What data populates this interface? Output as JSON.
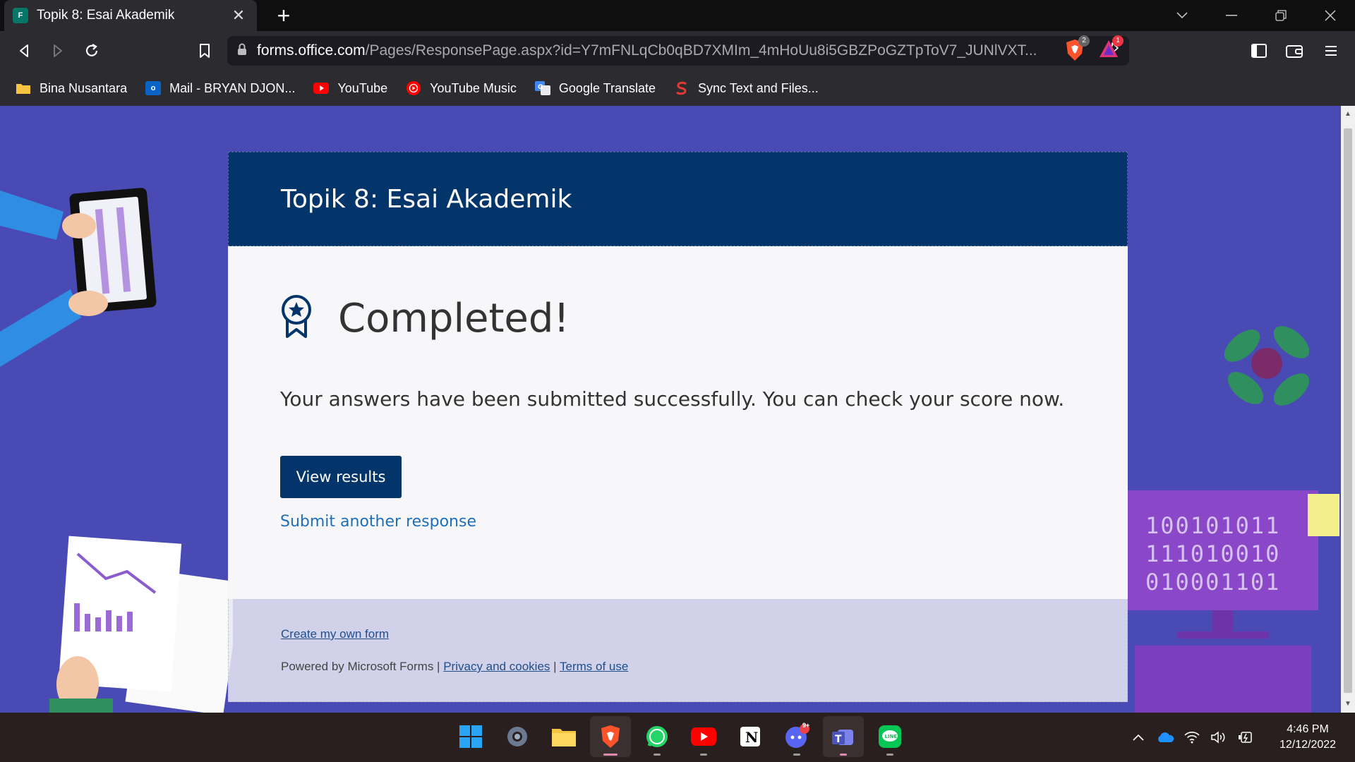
{
  "browser": {
    "tab_title": "Topik 8: Esai Akademik",
    "tab_favicon_text": "F",
    "url_host": "forms.office.com",
    "url_path": "/Pages/ResponsePage.aspx?id=Y7mFNLqCb0qBD7XMIm_4mHoUu8i5GBZPoGZTpToV7_JUNlVXT...",
    "shield_badge": "2",
    "rewards_badge": "1"
  },
  "bookmarks": [
    {
      "label": "Bina Nusantara",
      "icon": "folder-icon",
      "color": "#f5c542"
    },
    {
      "label": "Mail - BRYAN DJON...",
      "icon": "outlook-icon",
      "color": "#0a64c8"
    },
    {
      "label": "YouTube",
      "icon": "youtube-icon",
      "color": "#ff0000"
    },
    {
      "label": "YouTube Music",
      "icon": "youtube-music-icon",
      "color": "#ff0000"
    },
    {
      "label": "Google Translate",
      "icon": "google-translate-icon",
      "color": "#4285f4"
    },
    {
      "label": "Sync Text and Files...",
      "icon": "sync-icon",
      "color": "#e53935"
    }
  ],
  "form": {
    "title": "Topik 8: Esai Akademik",
    "completed": "Completed!",
    "message": "Your answers have been submitted successfully. You can check your score now.",
    "view_results": "View results",
    "submit_another": "Submit another response",
    "create_form": "Create my own form",
    "powered_by": "Powered by Microsoft Forms |",
    "privacy": "Privacy and cookies",
    "separator": "|",
    "terms": "Terms of use"
  },
  "decor": {
    "binary_lines": [
      "100101011",
      "111010010",
      "010001101"
    ]
  },
  "taskbar": {
    "apps": [
      "start-icon",
      "settings-icon",
      "file-explorer-icon",
      "brave-icon",
      "whatsapp-icon",
      "youtube-icon",
      "notion-icon",
      "discord-icon",
      "teams-icon",
      "line-icon"
    ],
    "discord_badge": "9+",
    "time": "4:46 PM",
    "date": "12/12/2022"
  },
  "colors": {
    "page_bg": "#4a4ab5",
    "header_bg": "#03356b",
    "link": "#1e6fb8"
  }
}
